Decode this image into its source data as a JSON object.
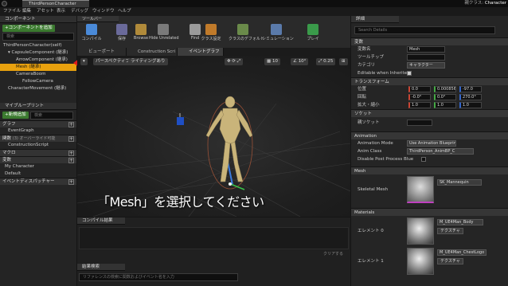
{
  "window": {
    "tab_title": "ThirdPersonCharacter",
    "parent_label": "親クラス:",
    "parent_value": "Character"
  },
  "menu": [
    "ファイル",
    "編集",
    "アセット",
    "表示",
    "デバッグ",
    "ウィンドウ",
    "ヘルプ"
  ],
  "left_panel": {
    "components_header": "コンポーネント",
    "add_component_button": "+コンポーネントを追加",
    "search_placeholder": "検索",
    "tree": [
      "ThirdPersonCharacter(self)",
      "CapsuleComponent (継承)",
      "ArrowComponent (継承)",
      "Mesh (継承)",
      "CameraBoom",
      "FollowCamera",
      "CharacterMovement (継承)"
    ],
    "mybp_header": "マイブループリント",
    "add_new_button": "+新規追加",
    "mybp_search_placeholder": "検索",
    "graph_section": "グラフ",
    "event_graph": "EventGraph",
    "functions_section": "関数",
    "functions_override": "(3) オーバーライド可能",
    "construction_script": "ConstructionScript",
    "macros_section": "マクロ",
    "variables_section": "変数",
    "my_character": "My Character",
    "default": "Default",
    "dispatchers_section": "イベントディスパッチャー"
  },
  "toolbar": {
    "tab_label": "ツールバー",
    "buttons": [
      "コンパイル",
      "保存",
      "Browse",
      "Hide Unrelated",
      "Find",
      "クラス設定",
      "クラスのデフォルト",
      "シミュレーション",
      "プレイ"
    ],
    "icon_colors": [
      "#4a8ad8",
      "#6a6a9a",
      "#b08a3a",
      "#7a7a7a",
      "#9a9a9a",
      "#c07a2a",
      "#6a8a4a",
      "#5a7aaa",
      "#3a9a4a"
    ]
  },
  "editor_tabs": [
    "ビューポート",
    "Construction Scri",
    "イベントグラフ"
  ],
  "viewport": {
    "perspective_button": "パースペクティブ",
    "lighting_button": "ライティングあり",
    "grid_snap": "10",
    "angle_snap": "10°",
    "scale_snap": "0.25"
  },
  "compile_results": {
    "tab_label": "コンパイル結果",
    "clear_button": "クリアする"
  },
  "search_results": {
    "tab_label": "結果検索",
    "placeholder": "リファレンスの検索に関数およびイベント名を入力"
  },
  "caption": "「Mesh」を選択してください",
  "details": {
    "tab_label": "詳細",
    "search_placeholder": "Search Details",
    "sections": {
      "variables": "変数",
      "transform": "トランスフォーム",
      "sockets": "ソケット",
      "animation": "Animation",
      "mesh": "Mesh",
      "materials": "Materials"
    },
    "variable_name_label": "変数名",
    "variable_name_value": "Mesh",
    "tooltip_label": "ツールチップ",
    "category_label": "カテゴリ",
    "category_value": "キャラクター",
    "editable_label": "Editable when Inherited",
    "location_label": "位置",
    "location": [
      "0.0",
      "0.000856",
      "-97.0"
    ],
    "rotation_label": "回転",
    "rotation": [
      "-0.0°",
      "0.0°",
      "270.0°"
    ],
    "scale_label": "拡大・縮小",
    "scale": [
      "1.0",
      "1.0",
      "1.0"
    ],
    "parent_socket_label": "親ソケット",
    "anim_mode_label": "Animation Mode",
    "anim_mode_value": "Use Animation Blueprint",
    "anim_class_label": "Anim Class",
    "anim_class_value": "ThirdPerson_AnimBP_C",
    "disable_post_label": "Disable Post Process Blue",
    "skeletal_mesh_label": "Skeletal Mesh",
    "skeletal_mesh_value": "SK_Mannequin",
    "element0_label": "エレメント 0",
    "element0_value": "M_UE4Man_Body",
    "element1_label": "エレメント 1",
    "element1_value": "M_UE4Man_ChestLogo",
    "texture_button": "テクスチャ"
  }
}
